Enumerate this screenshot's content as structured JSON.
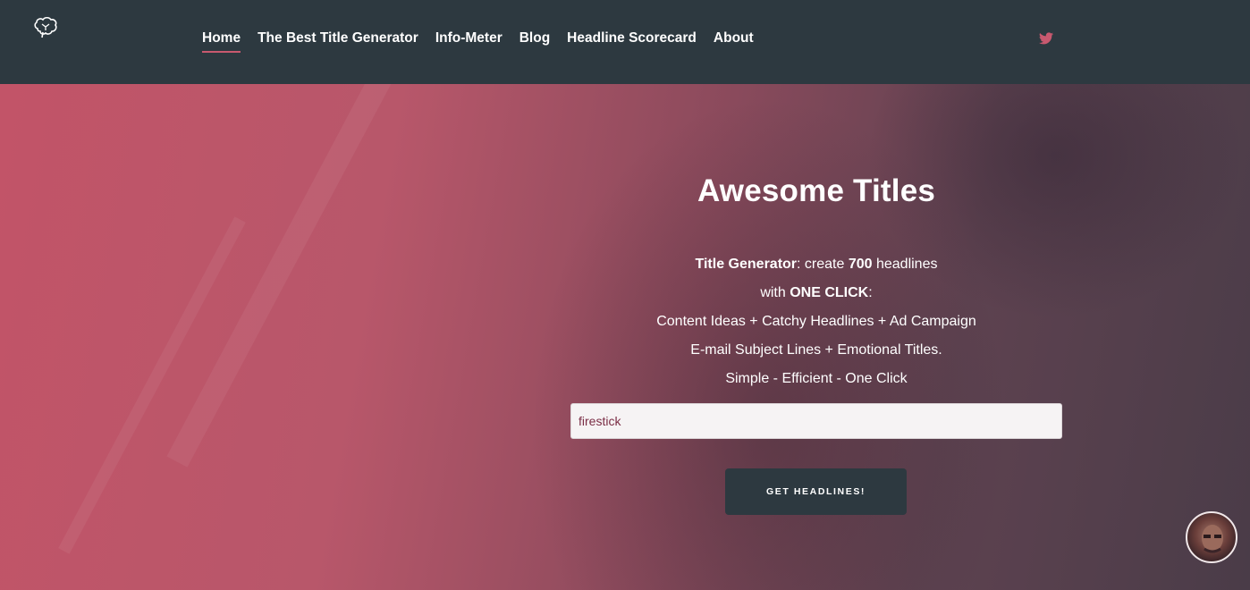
{
  "nav": {
    "logo_icon": "brain-icon",
    "items": [
      {
        "label": "Home",
        "active": true
      },
      {
        "label": "The Best Title Generator"
      },
      {
        "label": "Info-Meter"
      },
      {
        "label": "Blog"
      },
      {
        "label": "Headline Scorecard"
      },
      {
        "label": "About"
      }
    ],
    "social_icon": "twitter-icon"
  },
  "hero": {
    "title": "Awesome Titles",
    "desc": {
      "line1_bold": "Title Generator",
      "line1_a": ": create ",
      "line1_num": "700",
      "line1_b": " headlines",
      "line2_a": "with ",
      "line2_bold": "ONE CLICK",
      "line2_b": ":",
      "line3": "Content Ideas + Catchy Headlines + Ad Campaign",
      "line4": "E-mail Subject Lines + Emotional Titles.",
      "line5": "Simple - Efficient - One Click"
    },
    "input_value": "firestick",
    "button_label": "GET HEADLINES!"
  },
  "colors": {
    "navbar": "#2d3940",
    "accent": "#c8596f",
    "button": "#2d3940"
  }
}
